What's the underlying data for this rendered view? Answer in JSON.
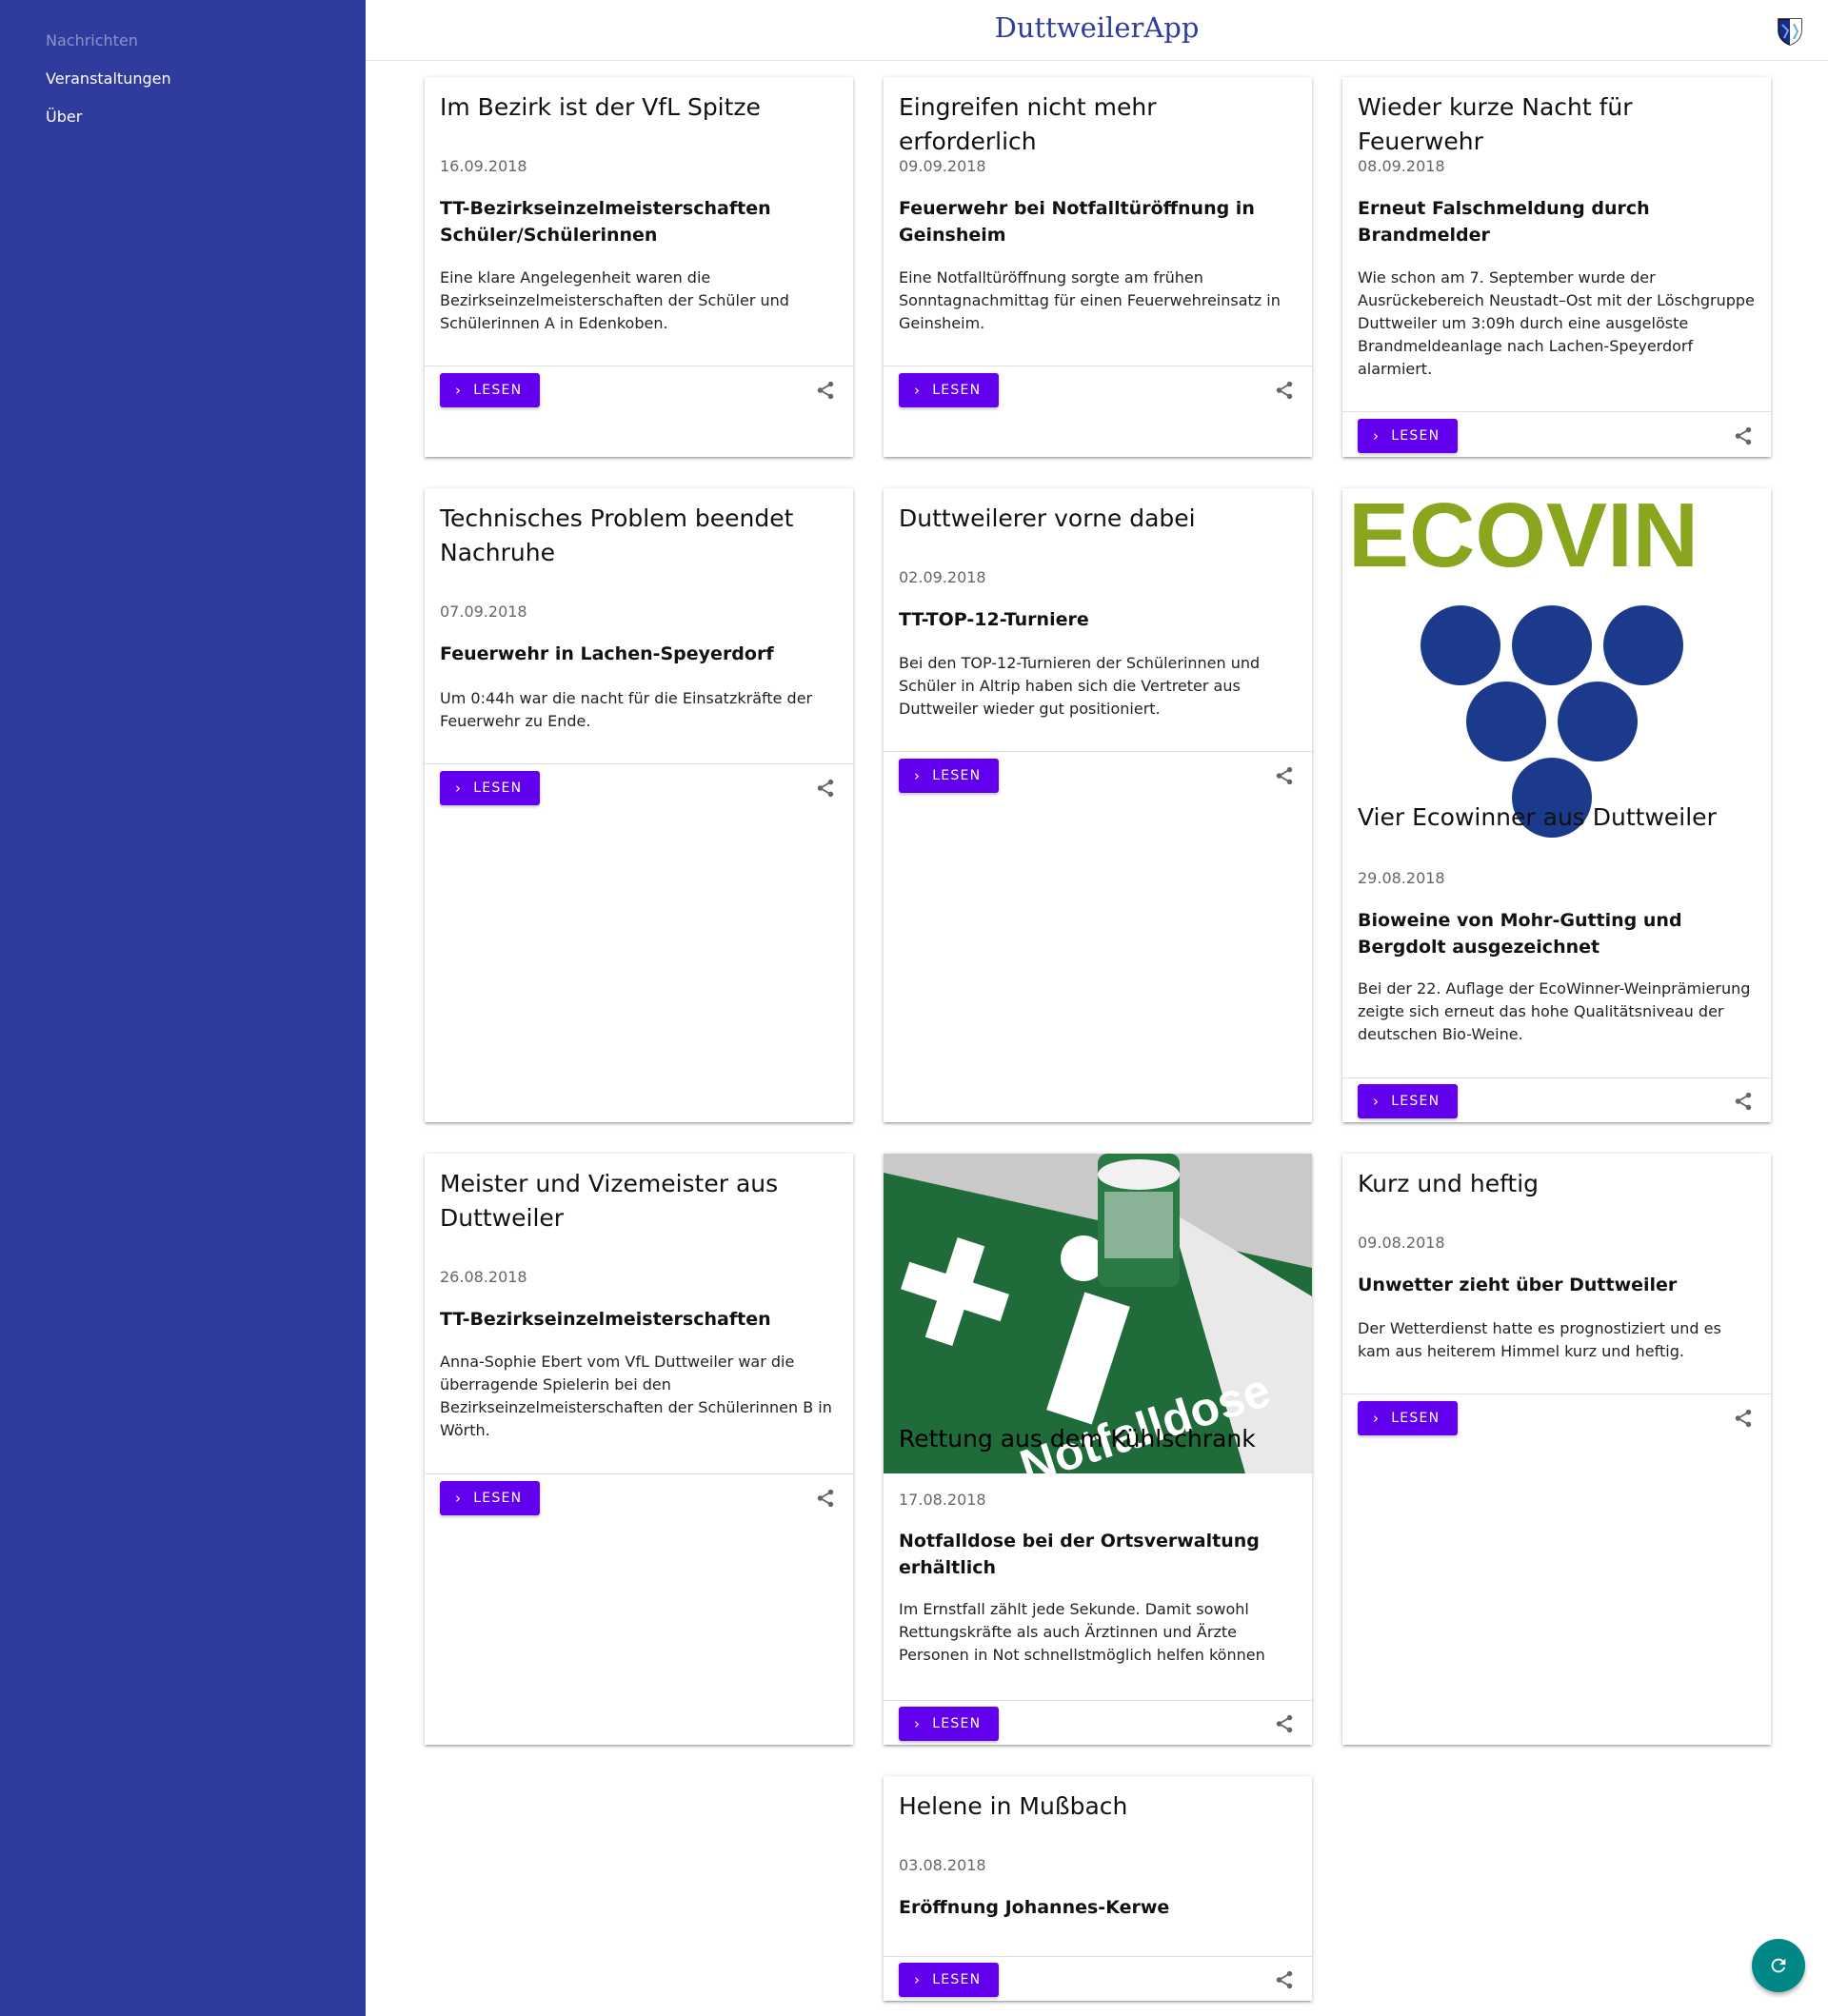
{
  "app": {
    "title": "DuttweilerApp"
  },
  "sidebar": {
    "items": [
      {
        "label": "Nachrichten",
        "active": true
      },
      {
        "label": "Veranstaltungen",
        "active": false
      },
      {
        "label": "Über",
        "active": false
      }
    ]
  },
  "cards": [
    {
      "title": "Im Bezirk ist der VfL Spitze",
      "date": "16.09.2018",
      "subtitle": "TT-Bezirkseinzelmeisterschaften Schüler/Schülerinnen",
      "text": "Eine klare Angelegenheit waren die Bezirkseinzelmeisterschaften der Schüler und Schülerinnen A in Edenkoben.",
      "button": "LESEN"
    },
    {
      "title": "Eingreifen nicht mehr erforderlich",
      "date": "09.09.2018",
      "subtitle": "Feuerwehr bei Notfalltüröffnung in Geinsheim",
      "text": "Eine Notfalltüröffnung sorgte am frühen Sonntagnachmittag für einen Feuerwehreinsatz in Geinsheim.",
      "button": "LESEN"
    },
    {
      "title": "Wieder kurze Nacht für Feuerwehr",
      "date": "08.09.2018",
      "subtitle": "Erneut Falschmeldung durch Brandmelder",
      "text": "Wie schon am 7. September wurde der Ausrückebereich Neustadt–Ost mit der Löschgruppe Duttweiler um 3:09h durch eine ausgelöste Brandmeldeanlage nach Lachen-Speyerdorf alarmiert.",
      "button": "LESEN"
    },
    {
      "title": "Technisches Problem beendet Nachruhe",
      "date": "07.09.2018",
      "subtitle": "Feuerwehr in Lachen-Speyerdorf",
      "text": "Um 0:44h war die nacht für die Einsatzkräfte der Feuerwehr zu Ende.",
      "button": "LESEN"
    },
    {
      "title": "Duttweilerer vorne dabei",
      "date": "02.09.2018",
      "subtitle": "TT-TOP-12-Turniere",
      "text": "Bei den TOP-12-Turnieren der Schülerinnen und Schüler in Altrip haben sich die Vertreter aus Duttweiler wieder gut positioniert.",
      "button": "LESEN"
    },
    {
      "title": "Vier Ecowinner aus Duttweiler",
      "date": "29.08.2018",
      "subtitle": "Bioweine von Mohr-Gutting und Bergdolt ausgezeichnet",
      "text": "Bei der 22. Auflage der EcoWinner-Weinprämierung zeigte sich erneut das hohe Qualitätsniveau der deutschen Bio-Weine.",
      "button": "LESEN",
      "image": "ECOVIN"
    },
    {
      "title": "Meister und Vizemeister aus Duttweiler",
      "date": "26.08.2018",
      "subtitle": "TT-Bezirkseinzelmeisterschaften",
      "text": "Anna-Sophie Ebert vom VfL Duttweiler war die überragende Spielerin bei den Bezirkseinzelmeisterschaften der Schülerinnen B in Wörth.",
      "button": "LESEN"
    },
    {
      "title": "Rettung aus dem Kühlschrank",
      "date": "17.08.2018",
      "subtitle": "Notfalldose bei der Ortsverwaltung erhältlich",
      "text": "Im Ernstfall zählt jede Sekunde. Damit sowohl Rettungskräfte als auch Ärztinnen und Ärzte Personen in Not schnellstmöglich helfen können",
      "button": "LESEN",
      "image": "Notfalldose"
    },
    {
      "title": "Kurz und heftig",
      "date": "09.08.2018",
      "subtitle": "Unwetter zieht über Duttweiler",
      "text": "Der Wetterdienst hatte es prognostiziert und es kam aus heiterem Himmel kurz und heftig.",
      "button": "LESEN"
    },
    {
      "title": "Helene in Mußbach",
      "date": "03.08.2018",
      "subtitle": "Eröffnung Johannes-Kerwe",
      "text": "",
      "button": "LESEN"
    }
  ],
  "colors": {
    "sidebar": "#2f3c9e",
    "button": "#6200ee",
    "fab": "#018786",
    "title": "#2f3c9e"
  },
  "icons": {
    "share": "share-icon",
    "chevron": "chevron-right-icon",
    "refresh": "refresh-icon",
    "crest": "crest-icon"
  }
}
